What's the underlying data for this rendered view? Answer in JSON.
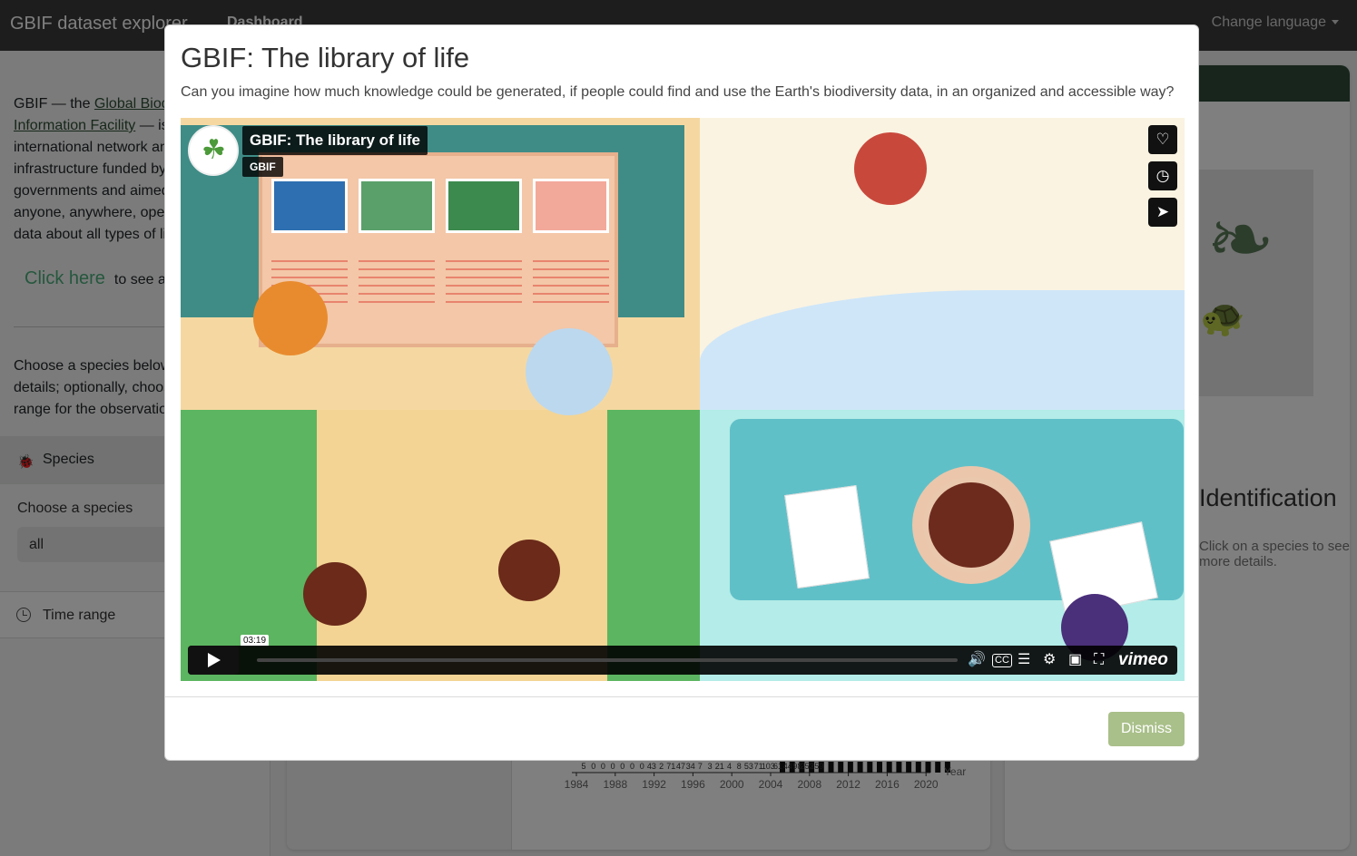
{
  "navbar": {
    "brand": "GBIF dataset explorer",
    "dashboard": "Dashboard",
    "change_language": "Change language"
  },
  "sidebar": {
    "intro_prefix": "GBIF — the",
    "intro_link": "Global Biodiversity Information Facility",
    "intro_rest": "— is an international network and data infrastructure funded by the world's governments and aimed at providing anyone, anywhere, open access to data about all types of life on Earth.",
    "click_link": "Click here",
    "click_rest": "to see an introduction",
    "choose_text": "Choose a species below to see more details; optionally, choose a time range for the observations.",
    "species_header": "Species",
    "choose_species_label": "Choose a species",
    "species_value": "all",
    "time_range_header": "Time range"
  },
  "main": {
    "identification_title": "Identification",
    "details_text": "Click on a species to see more details.",
    "histogram": {
      "xlabel": "Year",
      "tick_labels": [
        "1984",
        "1988",
        "1992",
        "1996",
        "2000",
        "2004",
        "2008",
        "2012",
        "2016",
        "2020"
      ],
      "value_labels": [
        "5",
        "0",
        "0",
        "0",
        "0",
        "0",
        "0",
        "43",
        "2",
        "71",
        "47",
        "34",
        "7",
        "3",
        "21",
        "4",
        "8",
        "53",
        "71",
        "103",
        "61",
        "44",
        "98",
        "253",
        "259"
      ]
    }
  },
  "modal": {
    "title": "GBIF: The library of life",
    "subtitle": "Can you imagine how much knowledge could be generated, if people could find and use the Earth's biodiversity data, in an organized and accessible way?",
    "dismiss_label": "Dismiss",
    "video": {
      "title": "GBIF: The library of life",
      "byline": "GBIF",
      "timecode": "03:19",
      "provider": "vimeo",
      "progress": 0
    }
  },
  "colors": {
    "navbar": "#3a3a3a",
    "accent_green": "#2e4a38",
    "link_green": "#4caf7d",
    "dismiss_bg": "#a9c08a"
  }
}
